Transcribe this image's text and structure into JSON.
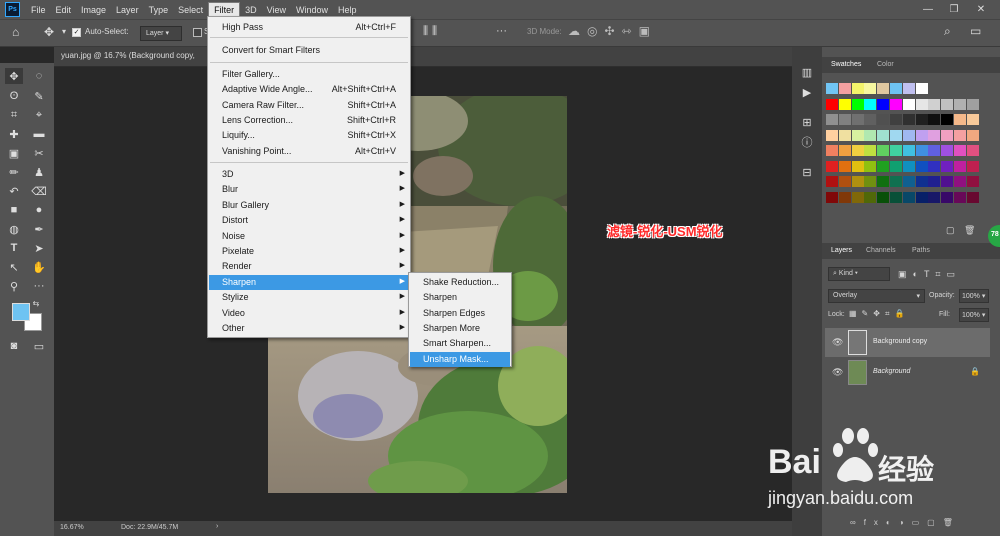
{
  "menubar": {
    "logo": "Ps",
    "items": [
      "File",
      "Edit",
      "Image",
      "Layer",
      "Type",
      "Select",
      "Filter",
      "3D",
      "View",
      "Window",
      "Help"
    ],
    "active": "Filter",
    "win_controls": [
      "—",
      "❐",
      "✕"
    ]
  },
  "options": {
    "auto_select_label": "Auto-Select:",
    "auto_select_value": "Layer",
    "show_transform_partial": "S",
    "mode_3d": "3D Mode:"
  },
  "document": {
    "tab_title": "yuan.jpg @ 16.7% (Background copy,",
    "zoom": "16.67%",
    "doc_size": "Doc: 22.9M/45.7M",
    "status_arrow": "›"
  },
  "filter_menu": {
    "items": [
      {
        "label": "High Pass",
        "shortcut": "Alt+Ctrl+F"
      },
      {
        "label": "Convert for Smart Filters",
        "shortcut": ""
      },
      {
        "label": "Filter Gallery...",
        "shortcut": ""
      },
      {
        "label": "Adaptive Wide Angle...",
        "shortcut": "Alt+Shift+Ctrl+A"
      },
      {
        "label": "Camera Raw Filter...",
        "shortcut": "Shift+Ctrl+A"
      },
      {
        "label": "Lens Correction...",
        "shortcut": "Shift+Ctrl+R"
      },
      {
        "label": "Liquify...",
        "shortcut": "Shift+Ctrl+X"
      },
      {
        "label": "Vanishing Point...",
        "shortcut": "Alt+Ctrl+V"
      },
      {
        "label": "3D",
        "shortcut": ""
      },
      {
        "label": "Blur",
        "shortcut": ""
      },
      {
        "label": "Blur Gallery",
        "shortcut": ""
      },
      {
        "label": "Distort",
        "shortcut": ""
      },
      {
        "label": "Noise",
        "shortcut": ""
      },
      {
        "label": "Pixelate",
        "shortcut": ""
      },
      {
        "label": "Render",
        "shortcut": ""
      },
      {
        "label": "Sharpen",
        "shortcut": ""
      },
      {
        "label": "Stylize",
        "shortcut": ""
      },
      {
        "label": "Video",
        "shortcut": ""
      },
      {
        "label": "Other",
        "shortcut": ""
      }
    ],
    "highlighted": "Sharpen"
  },
  "sharpen_menu": {
    "items": [
      "Shake Reduction...",
      "Sharpen",
      "Sharpen Edges",
      "Sharpen More",
      "Smart Sharpen...",
      "Unsharp Mask..."
    ],
    "highlighted": "Unsharp Mask..."
  },
  "annotation": "滤镜-锐化-USM锐化",
  "panels": {
    "swatch_tabs": [
      "Swatches",
      "Color"
    ],
    "layer_tabs": [
      "Layers",
      "Channels",
      "Paths"
    ],
    "kind": "Kind",
    "blend_mode": "Overlay",
    "opacity_label": "Opacity:",
    "opacity_value": "100%",
    "lock_label": "Lock:",
    "fill_label": "Fill:",
    "fill_value": "100%",
    "layers": [
      {
        "name": "Background copy"
      },
      {
        "name": "Background"
      }
    ],
    "badge": "78"
  },
  "watermark": {
    "brand_left": "Bai",
    "brand_right": "经验",
    "url": "jingyan.baidu.com"
  },
  "colors": {
    "accent": "#3c99e4",
    "fg_color": "#6ec3f2",
    "bg_color": "#ffffff",
    "annotation": "#ff2a2a"
  }
}
